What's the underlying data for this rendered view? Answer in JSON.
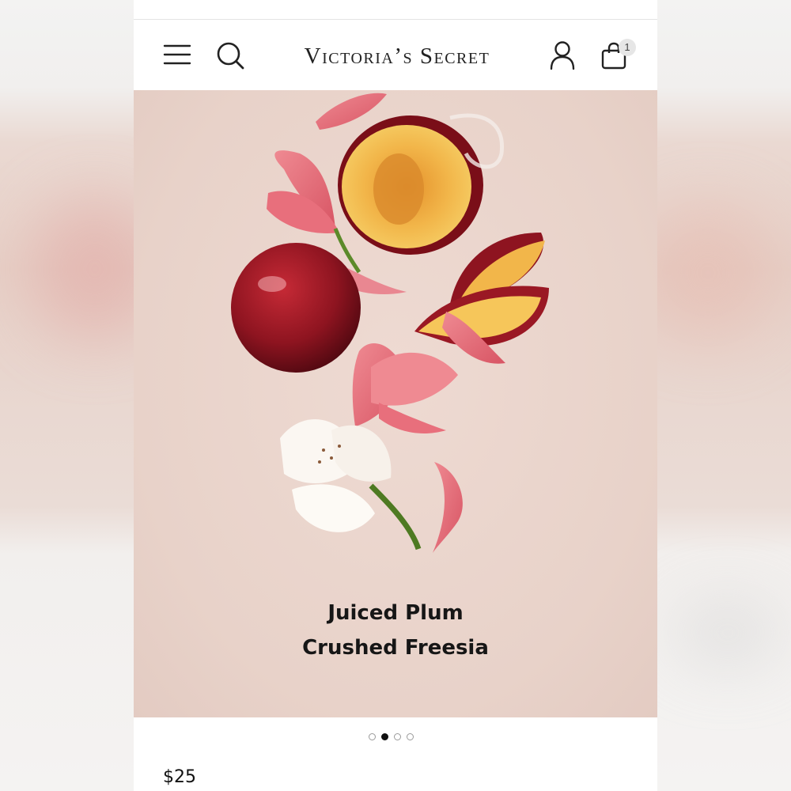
{
  "brand": {
    "logo_text": "Victoria’s Secret"
  },
  "header": {
    "bag_count": "1"
  },
  "icons": [
    "menu-icon",
    "search-icon",
    "account-icon",
    "shopping-bag-icon"
  ],
  "hero": {
    "caption_line1": "Juiced Plum",
    "caption_line2": "Crushed Freesia"
  },
  "carousel": {
    "slide_count": 4,
    "active_index": 1
  },
  "product": {
    "price": "$25"
  },
  "colors": {
    "hero_bg": "#e8d2c9",
    "text": "#161616",
    "plum": "#8e1420",
    "flesh": "#f2b64a",
    "petal_pink": "#e8727e"
  }
}
